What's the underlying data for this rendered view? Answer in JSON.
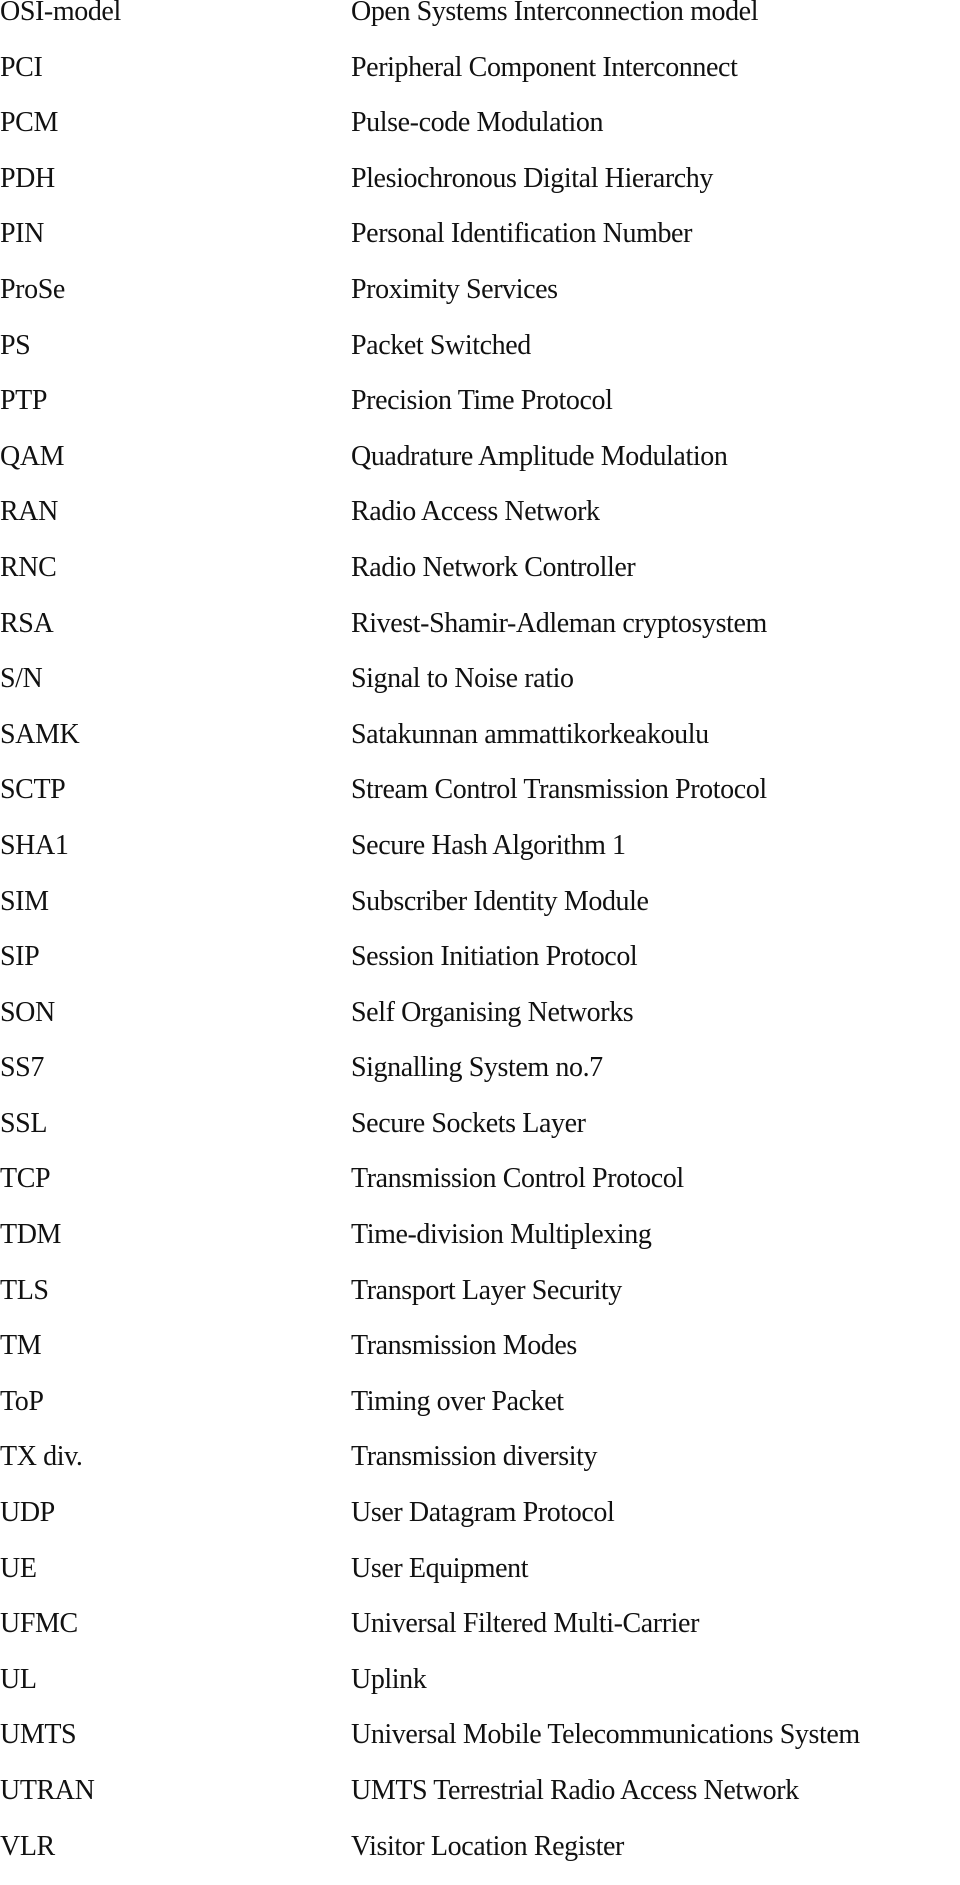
{
  "document": {
    "abbreviations": [
      {
        "term": "OSI-model",
        "definition": "Open Systems Interconnection model"
      },
      {
        "term": "PCI",
        "definition": "Peripheral Component Interconnect"
      },
      {
        "term": "PCM",
        "definition": "Pulse-code Modulation"
      },
      {
        "term": "PDH",
        "definition": "Plesiochronous Digital Hierarchy"
      },
      {
        "term": "PIN",
        "definition": "Personal Identification Number"
      },
      {
        "term": "ProSe",
        "definition": "Proximity Services"
      },
      {
        "term": "PS",
        "definition": "Packet Switched"
      },
      {
        "term": "PTP",
        "definition": "Precision Time Protocol"
      },
      {
        "term": "QAM",
        "definition": "Quadrature Amplitude Modulation"
      },
      {
        "term": "RAN",
        "definition": "Radio Access Network"
      },
      {
        "term": "RNC",
        "definition": "Radio Network Controller"
      },
      {
        "term": "RSA",
        "definition": "Rivest-Shamir-Adleman cryptosystem"
      },
      {
        "term": "S/N",
        "definition": "Signal to Noise ratio"
      },
      {
        "term": "SAMK",
        "definition": "Satakunnan ammattikorkeakoulu"
      },
      {
        "term": "SCTP",
        "definition": "Stream Control Transmission Protocol"
      },
      {
        "term": "SHA1",
        "definition": "Secure Hash Algorithm 1"
      },
      {
        "term": "SIM",
        "definition": "Subscriber Identity Module"
      },
      {
        "term": "SIP",
        "definition": "Session Initiation Protocol"
      },
      {
        "term": "SON",
        "definition": "Self Organising Networks"
      },
      {
        "term": "SS7",
        "definition": "Signalling System no.7"
      },
      {
        "term": "SSL",
        "definition": "Secure Sockets Layer"
      },
      {
        "term": "TCP",
        "definition": "Transmission Control Protocol"
      },
      {
        "term": "TDM",
        "definition": "Time-division Multiplexing"
      },
      {
        "term": "TLS",
        "definition": "Transport Layer Security"
      },
      {
        "term": "TM",
        "definition": "Transmission Modes"
      },
      {
        "term": "ToP",
        "definition": "Timing over Packet"
      },
      {
        "term": "TX div.",
        "definition": "Transmission diversity"
      },
      {
        "term": "UDP",
        "definition": "User Datagram Protocol"
      },
      {
        "term": "UE",
        "definition": "User Equipment"
      },
      {
        "term": "UFMC",
        "definition": "Universal Filtered Multi-Carrier"
      },
      {
        "term": "UL",
        "definition": "Uplink"
      },
      {
        "term": "UMTS",
        "definition": "Universal Mobile Telecommunications System"
      },
      {
        "term": "UTRAN",
        "definition": "UMTS Terrestrial Radio Access Network"
      },
      {
        "term": "VLR",
        "definition": "Visitor Location Register"
      }
    ]
  }
}
